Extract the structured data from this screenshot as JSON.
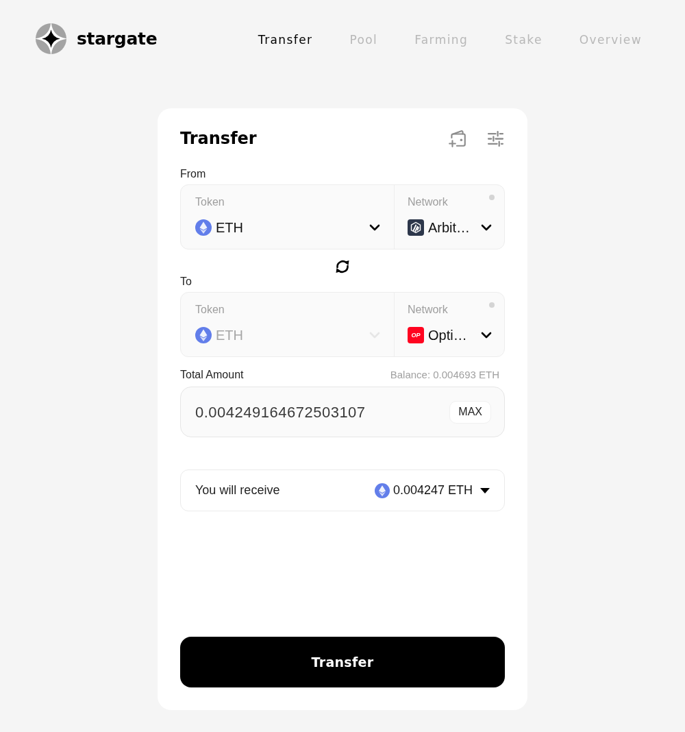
{
  "brand": {
    "name": "stargate"
  },
  "nav": [
    {
      "label": "Transfer",
      "selected": true
    },
    {
      "label": "Pool",
      "selected": false
    },
    {
      "label": "Farming",
      "selected": false
    },
    {
      "label": "Stake",
      "selected": false
    },
    {
      "label": "Overview",
      "selected": false
    }
  ],
  "card": {
    "title": "Transfer"
  },
  "sections": [
    {
      "label": "From",
      "token": {
        "label": "Token",
        "value": "ETH",
        "disabled": false
      },
      "network": {
        "label": "Network",
        "value": "Arbit…",
        "kind": "mountain"
      }
    },
    {
      "label": "To",
      "token": {
        "label": "Token",
        "value": "ETH",
        "disabled": true
      },
      "network": {
        "label": "Network",
        "value": "Opti…",
        "kind": "lettered",
        "logo_text": "OP"
      }
    }
  ],
  "amount": {
    "label": "Total Amount",
    "balance": "Balance: 0.004693 ETH",
    "value": "0.004249164672503107",
    "max_button": "MAX"
  },
  "receive": {
    "label": "You will receive",
    "value": "0.004247 ETH"
  },
  "submit_button": "Transfer"
}
